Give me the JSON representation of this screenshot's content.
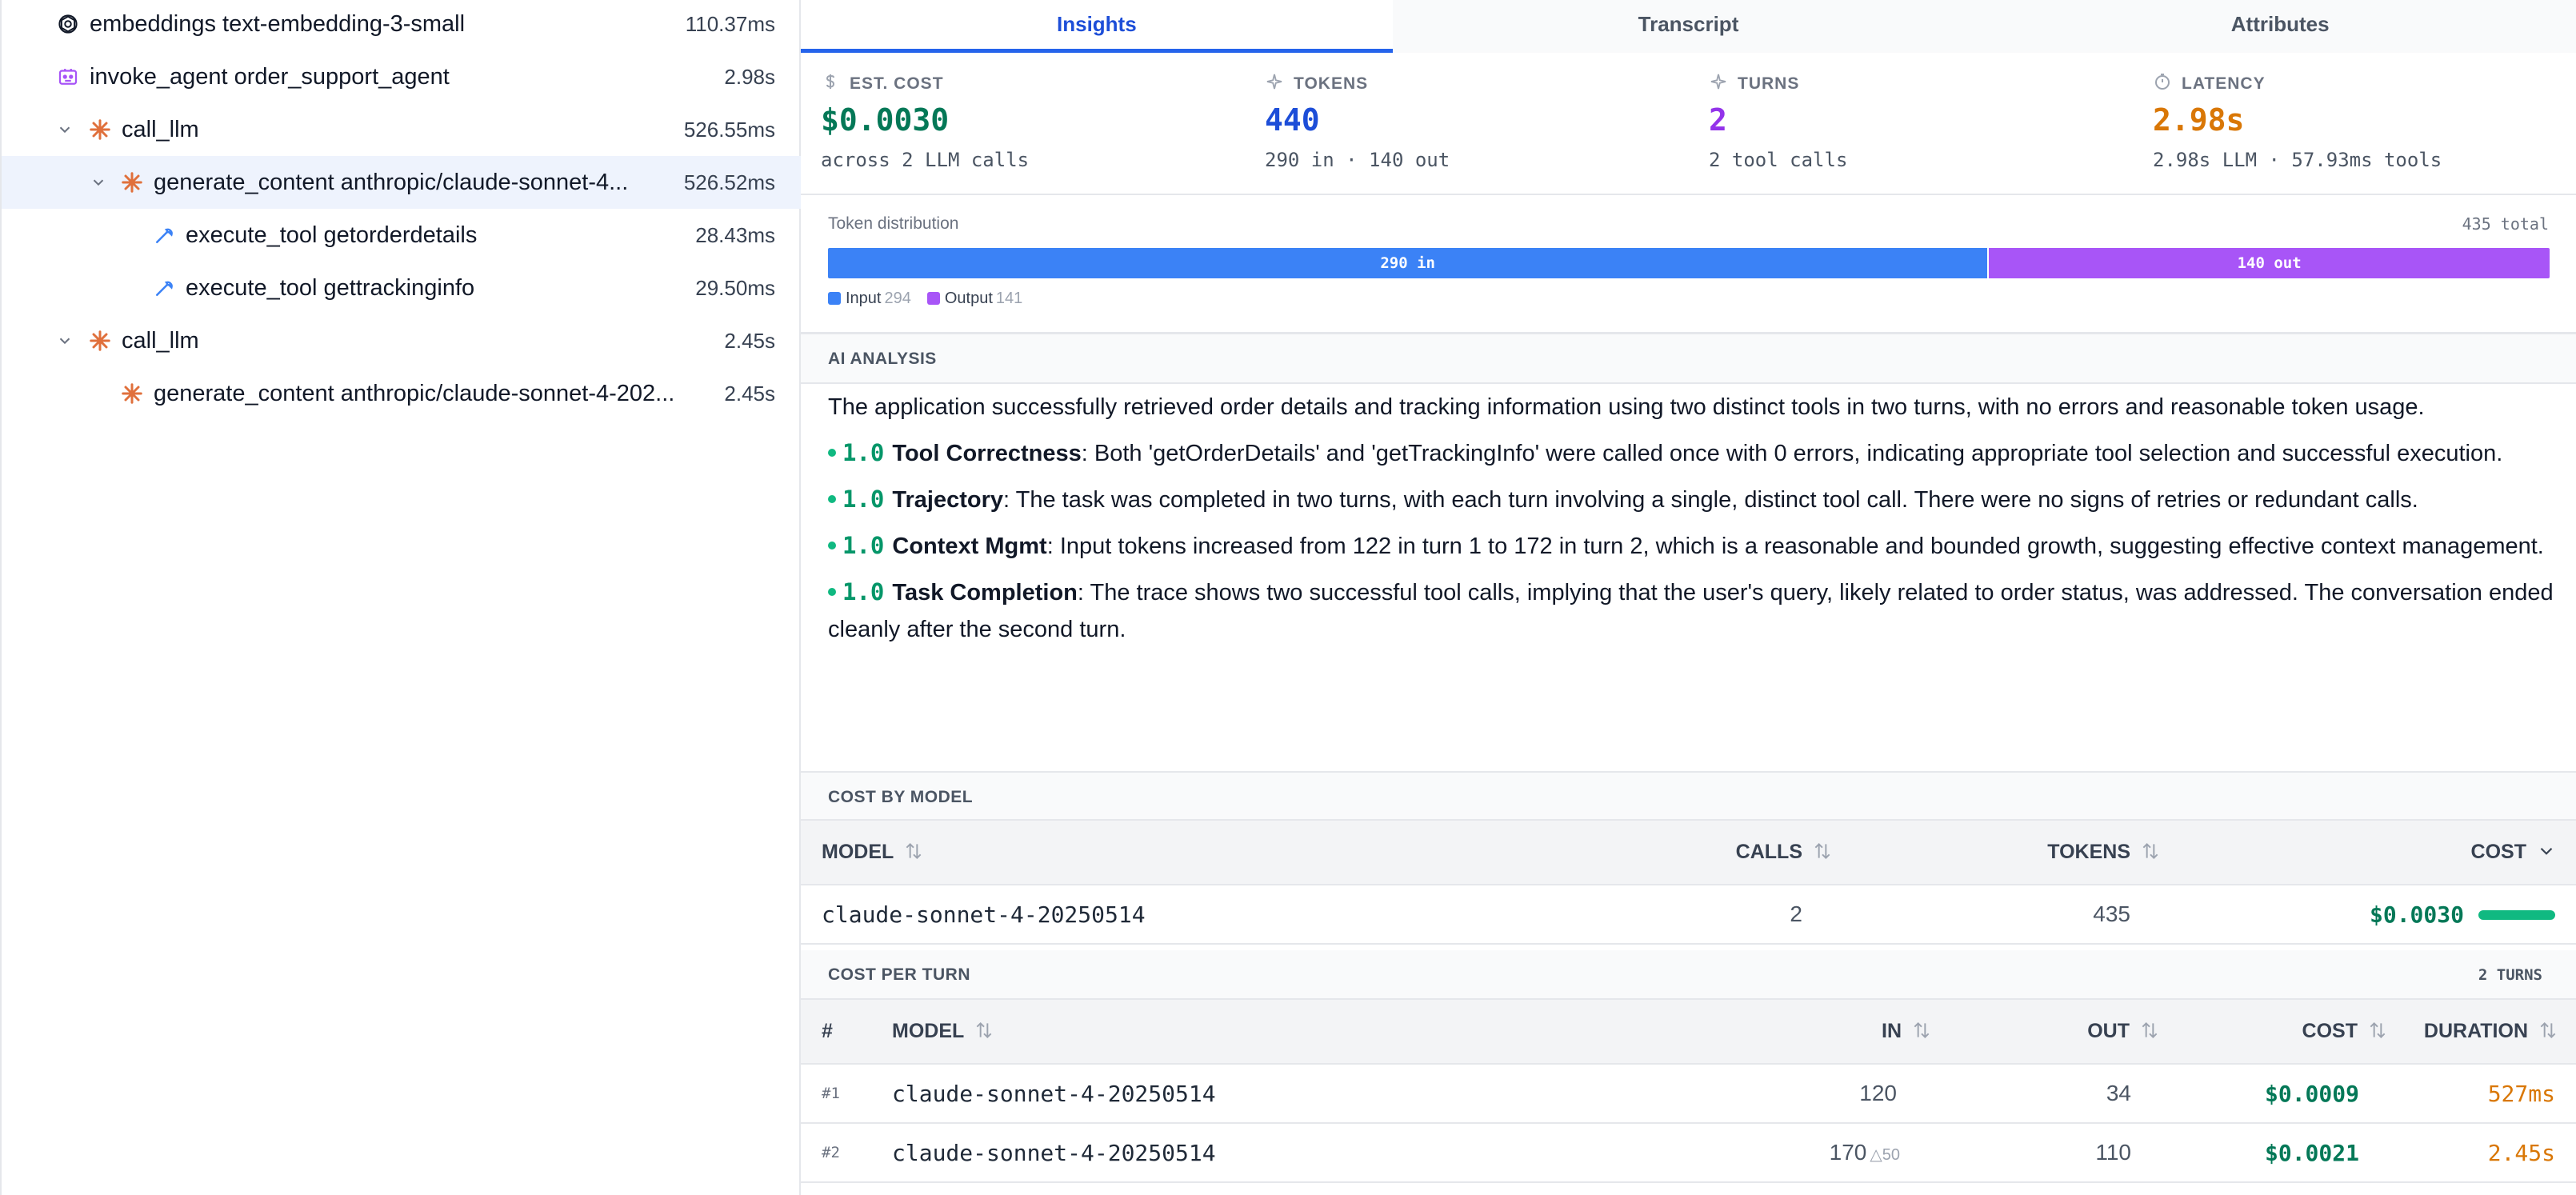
{
  "tree": [
    {
      "label": "embeddings text-embedding-3-small",
      "duration": "110.37ms",
      "icon": "openai-icon",
      "chevron": false
    },
    {
      "label": "invoke_agent order_support_agent",
      "duration": "2.98s",
      "icon": "agent-icon",
      "chevron": false
    },
    {
      "label": "call_llm",
      "duration": "526.55ms",
      "icon": "anthropic-icon",
      "chevron": true
    },
    {
      "label": "generate_content anthropic/claude-sonnet-4...",
      "duration": "526.52ms",
      "icon": "anthropic-icon",
      "chevron": true,
      "selected": true
    },
    {
      "label": "execute_tool getorderdetails",
      "duration": "28.43ms",
      "icon": "wrench-icon",
      "chevron": false
    },
    {
      "label": "execute_tool gettrackinginfo",
      "duration": "29.50ms",
      "icon": "wrench-icon",
      "chevron": false
    },
    {
      "label": "call_llm",
      "duration": "2.45s",
      "icon": "anthropic-icon",
      "chevron": true
    },
    {
      "label": "generate_content anthropic/claude-sonnet-4-202...",
      "duration": "2.45s",
      "icon": "anthropic-icon",
      "chevron": false
    }
  ],
  "tabs": [
    "Insights",
    "Transcript",
    "Attributes"
  ],
  "metrics": [
    {
      "label": "EST. COST",
      "value": "$0.0030",
      "sub": "across 2 LLM calls",
      "color": "#047857",
      "icon": "dollar-icon"
    },
    {
      "label": "TOKENS",
      "value": "440",
      "sub": "290 in · 140 out",
      "color": "#1d4ed8",
      "icon": "sparkle-icon"
    },
    {
      "label": "TURNS",
      "value": "2",
      "sub": "2 tool calls",
      "color": "#9333ea",
      "icon": "sparkle-icon"
    },
    {
      "label": "LATENCY",
      "value": "2.98s",
      "sub": "2.98s LLM · 57.93ms tools",
      "color": "#d97706",
      "icon": "timer-icon"
    }
  ],
  "token_distribution": {
    "label": "Token distribution",
    "total": "435 total",
    "in_label": "290 in",
    "out_label": "140 out",
    "in_fraction": 0.6744,
    "legend_input": "Input",
    "legend_input_value": "294",
    "legend_output": "Output",
    "legend_output_value": "141",
    "colors": {
      "input": "#3b82f6",
      "output": "#a855f7"
    }
  },
  "analysis": {
    "title": "AI ANALYSIS",
    "summary": "The application successfully retrieved order details and tracking information using two distinct tools in two turns, with no errors and reasonable token usage.",
    "items": [
      {
        "score": "1.0",
        "name": "Tool Correctness",
        "text": ": Both 'getOrderDetails' and 'getTrackingInfo' were called once with 0 errors, indicating appropriate tool selection and successful execution."
      },
      {
        "score": "1.0",
        "name": "Trajectory",
        "text": ": The task was completed in two turns, with each turn involving a single, distinct tool call. There were no signs of retries or redundant calls."
      },
      {
        "score": "1.0",
        "name": "Context Mgmt",
        "text": ": Input tokens increased from 122 in turn 1 to 172 in turn 2, which is a reasonable and bounded growth, suggesting effective context management."
      },
      {
        "score": "1.0",
        "name": "Task Completion",
        "text": ": The trace shows two successful tool calls, implying that the user's query, likely related to order status, was addressed. The conversation ended cleanly after the second turn."
      }
    ]
  },
  "cost_by_model": {
    "title": "COST BY MODEL",
    "columns": [
      "MODEL",
      "CALLS",
      "TOKENS",
      "COST"
    ],
    "rows": [
      {
        "model": "claude-sonnet-4-20250514",
        "calls": "2",
        "tokens": "435",
        "cost": "$0.0030"
      }
    ]
  },
  "cost_per_turn": {
    "title": "COST PER TURN",
    "badge": "2 TURNS",
    "columns": [
      "#",
      "MODEL",
      "IN",
      "OUT",
      "COST",
      "DURATION"
    ],
    "rows": [
      {
        "num": "#1",
        "model": "claude-sonnet-4-20250514",
        "in": "120",
        "delta": "",
        "out": "34",
        "cost": "$0.0009",
        "duration": "527ms"
      },
      {
        "num": "#2",
        "model": "claude-sonnet-4-20250514",
        "in": "170",
        "delta": "△50",
        "out": "110",
        "cost": "$0.0021",
        "duration": "2.45s"
      }
    ]
  }
}
